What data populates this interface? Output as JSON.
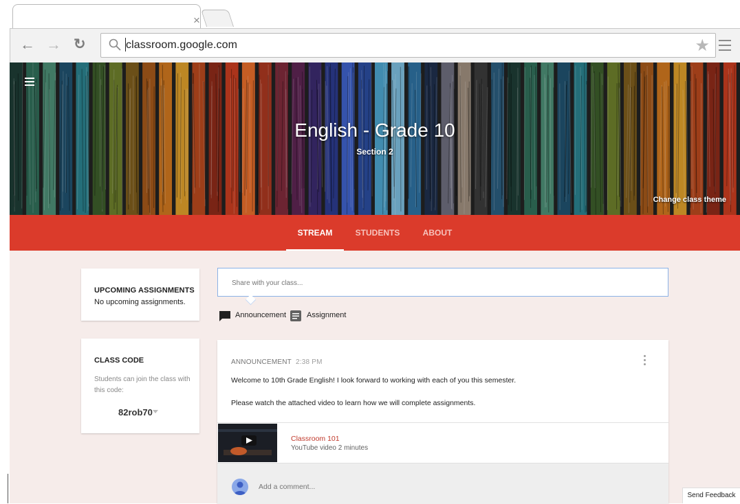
{
  "browser": {
    "tab_close": "×",
    "url": "classroom.google.com"
  },
  "banner": {
    "title": "English - Grade 10",
    "section": "Section 2",
    "change_theme": "Change class theme"
  },
  "nav": {
    "tabs": [
      {
        "label": "STREAM",
        "active": true
      },
      {
        "label": "STUDENTS",
        "active": false
      },
      {
        "label": "ABOUT",
        "active": false
      }
    ],
    "accent_color": "#db3b2b"
  },
  "upcoming": {
    "title": "UPCOMING ASSIGNMENTS",
    "empty": "No upcoming assignments."
  },
  "class_code": {
    "title": "CLASS CODE",
    "description": "Students can join the class with this code:",
    "code": "82rob70"
  },
  "compose": {
    "placeholder": "Share with your class...",
    "announcement": "Announcement",
    "assignment": "Assignment"
  },
  "post": {
    "type": "ANNOUNCEMENT",
    "time": "2:38 PM",
    "line1": "Welcome to 10th Grade English! I look forward to working with each of you this semester.",
    "line2": "Please watch the attached video to learn how we will complete assignments.",
    "attachment": {
      "title": "Classroom 101",
      "meta": "YouTube video  2 minutes"
    },
    "comment_placeholder": "Add a comment..."
  },
  "feedback": "Send Feedback"
}
